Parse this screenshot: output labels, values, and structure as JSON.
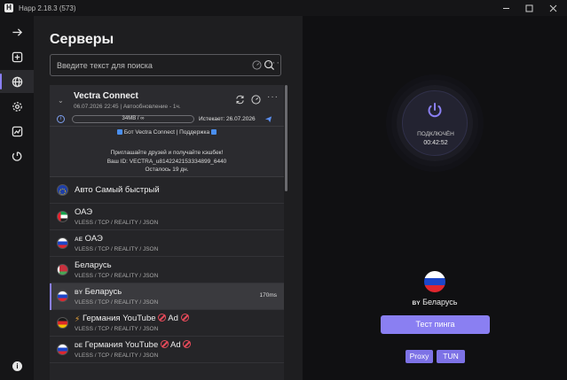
{
  "window": {
    "title": "Happ 2.18.3 (573)",
    "logo_letter": "H"
  },
  "nav": [
    "arrow-right-icon",
    "add-square-icon",
    "globe-icon",
    "gear-icon",
    "chart-icon",
    "timer-icon"
  ],
  "page_title": "Серверы",
  "search": {
    "placeholder": "Введите текст для поиска"
  },
  "subscription": {
    "name": "Vectra Connect",
    "meta": "06.07.2026 22:45 | Автообновление - 1ч.",
    "traffic": "34MB / ∞",
    "expires": "Истекает: 26.07.2026",
    "bot_line": "Бот Vectra Connect | Поддержка",
    "desc_1": "Приглашайте друзей и получайте кэшбек!",
    "desc_2": "Ваш ID: VECTRA_u8142242153334899_6440",
    "desc_3": "Осталось 19 дн."
  },
  "servers": [
    {
      "cc": "",
      "name": "Авто Самый быстрый",
      "proto": "",
      "ping": "",
      "flag": "eu"
    },
    {
      "cc": "",
      "name": "ОАЭ",
      "proto": "VLESS / TCP / REALITY / JSON",
      "ping": "",
      "flag": "ae"
    },
    {
      "cc": "AE",
      "name": "ОАЭ",
      "proto": "VLESS / TCP / REALITY / JSON",
      "ping": "",
      "flag": "ru"
    },
    {
      "cc": "",
      "name": "Беларусь",
      "proto": "VLESS / TCP / REALITY / JSON",
      "ping": "",
      "flag": "by"
    },
    {
      "cc": "BY",
      "name": "Беларусь",
      "proto": "VLESS / TCP / REALITY / JSON",
      "ping": "170ms",
      "flag": "ru"
    },
    {
      "cc": "",
      "name": "Германия YouTube",
      "ad": "Ad",
      "proto": "VLESS / TCP / REALITY / JSON",
      "ping": "",
      "flag": "de"
    },
    {
      "cc": "DE",
      "name": "Германия YouTube",
      "ad": "Ad",
      "proto": "VLESS / TCP / REALITY / JSON",
      "ping": "",
      "flag": "ru"
    }
  ],
  "connection": {
    "status": "ПОДКЛЮЧЁН",
    "time": "00:42:52",
    "country_code": "BY",
    "country": "Беларусь",
    "ping_test": "Тест пинга",
    "proxy": "Proxy",
    "tun": "TUN"
  },
  "colors": {
    "accent": "#8a7ff2",
    "background": "#1e1e20",
    "connection_bg": "#101012"
  }
}
